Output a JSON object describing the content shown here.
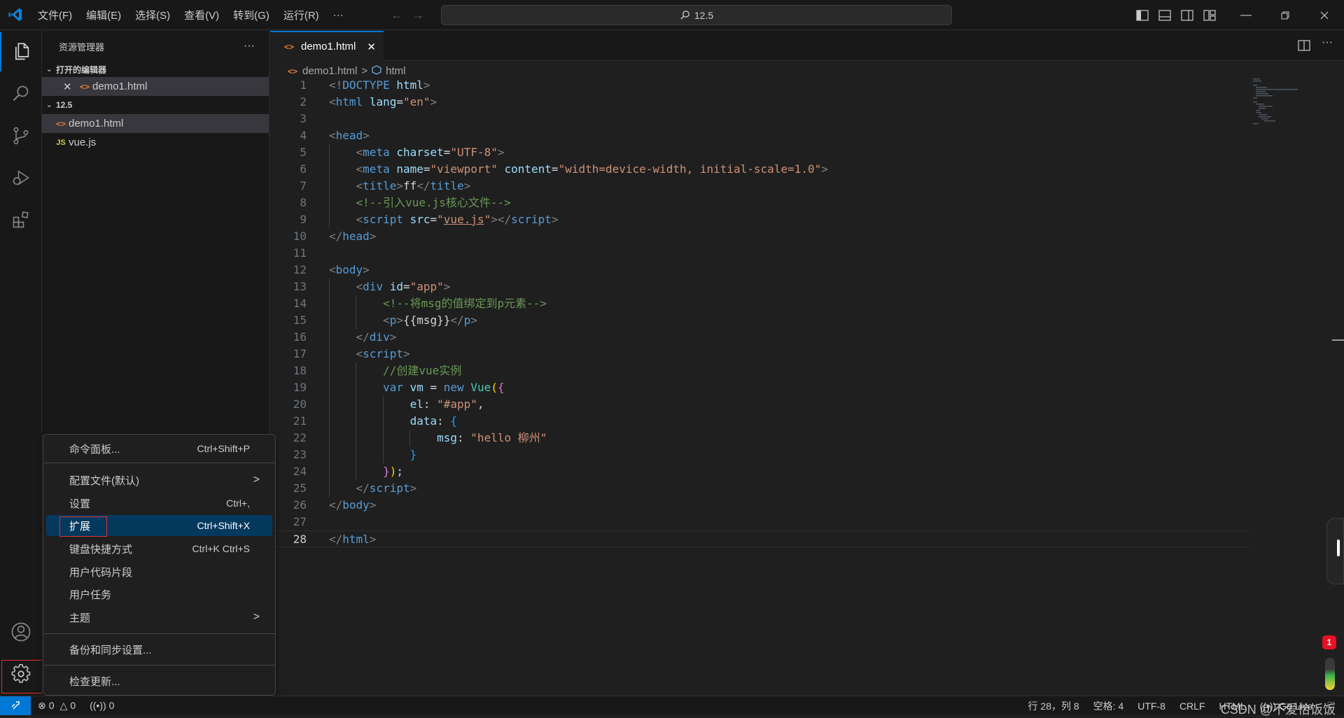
{
  "titlebar": {
    "menus": [
      "文件(F)",
      "编辑(E)",
      "选择(S)",
      "查看(V)",
      "转到(G)",
      "运行(R)",
      "···"
    ],
    "search": "12.5"
  },
  "sidebar": {
    "title": "资源管理器",
    "more": "···",
    "open_editors_title": "打开的编辑器",
    "open_editors": [
      {
        "name": "demo1.html"
      }
    ],
    "folder_title": "12.5",
    "files": [
      {
        "name": "demo1.html",
        "icon": "<>",
        "type": "html"
      },
      {
        "name": "vue.js",
        "icon": "JS",
        "type": "js"
      }
    ]
  },
  "tab": {
    "label": "demo1.html"
  },
  "breadcrumb": {
    "file": "demo1.html",
    "sep": ">",
    "symbol": "html"
  },
  "editor": {
    "lines": [
      [
        [
          "t-tag",
          "<!"
        ],
        [
          "t-name",
          "DOCTYPE"
        ],
        [
          "t-txt",
          " "
        ],
        [
          "t-attr",
          "html"
        ],
        [
          "t-tag",
          ">"
        ]
      ],
      [
        [
          "t-tag",
          "<"
        ],
        [
          "t-name",
          "html"
        ],
        [
          "t-txt",
          " "
        ],
        [
          "t-attr",
          "lang"
        ],
        [
          "t-txt",
          "="
        ],
        [
          "t-str",
          "\"en\""
        ],
        [
          "t-tag",
          ">"
        ]
      ],
      [],
      [
        [
          "t-tag",
          "<"
        ],
        [
          "t-name",
          "head"
        ],
        [
          "t-tag",
          ">"
        ]
      ],
      [
        [
          "t-txt",
          "    "
        ],
        [
          "t-tag",
          "<"
        ],
        [
          "t-name",
          "meta"
        ],
        [
          "t-txt",
          " "
        ],
        [
          "t-attr",
          "charset"
        ],
        [
          "t-txt",
          "="
        ],
        [
          "t-str",
          "\"UTF-8\""
        ],
        [
          "t-tag",
          ">"
        ]
      ],
      [
        [
          "t-txt",
          "    "
        ],
        [
          "t-tag",
          "<"
        ],
        [
          "t-name",
          "meta"
        ],
        [
          "t-txt",
          " "
        ],
        [
          "t-attr",
          "name"
        ],
        [
          "t-txt",
          "="
        ],
        [
          "t-str",
          "\"viewport\""
        ],
        [
          "t-txt",
          " "
        ],
        [
          "t-attr",
          "content"
        ],
        [
          "t-txt",
          "="
        ],
        [
          "t-str",
          "\"width=device-width, initial-scale=1.0\""
        ],
        [
          "t-tag",
          ">"
        ]
      ],
      [
        [
          "t-txt",
          "    "
        ],
        [
          "t-tag",
          "<"
        ],
        [
          "t-name",
          "title"
        ],
        [
          "t-tag",
          ">"
        ],
        [
          "t-txt",
          "ff"
        ],
        [
          "t-tag",
          "</"
        ],
        [
          "t-name",
          "title"
        ],
        [
          "t-tag",
          ">"
        ]
      ],
      [
        [
          "t-txt",
          "    "
        ],
        [
          "t-com",
          "<!--引入vue.js核心文件-->"
        ]
      ],
      [
        [
          "t-txt",
          "    "
        ],
        [
          "t-tag",
          "<"
        ],
        [
          "t-name",
          "script"
        ],
        [
          "t-txt",
          " "
        ],
        [
          "t-attr",
          "src"
        ],
        [
          "t-txt",
          "="
        ],
        [
          "t-str",
          "\""
        ],
        [
          "t-str u",
          "vue.js"
        ],
        [
          "t-str",
          "\""
        ],
        [
          "t-tag",
          "></"
        ],
        [
          "t-name",
          "script"
        ],
        [
          "t-tag",
          ">"
        ]
      ],
      [
        [
          "t-tag",
          "</"
        ],
        [
          "t-name",
          "head"
        ],
        [
          "t-tag",
          ">"
        ]
      ],
      [],
      [
        [
          "t-tag",
          "<"
        ],
        [
          "t-name",
          "body"
        ],
        [
          "t-tag",
          ">"
        ]
      ],
      [
        [
          "t-txt",
          "    "
        ],
        [
          "t-tag",
          "<"
        ],
        [
          "t-name",
          "div"
        ],
        [
          "t-txt",
          " "
        ],
        [
          "t-attr",
          "id"
        ],
        [
          "t-txt",
          "="
        ],
        [
          "t-str",
          "\"app\""
        ],
        [
          "t-tag",
          ">"
        ]
      ],
      [
        [
          "t-txt",
          "        "
        ],
        [
          "t-com",
          "<!--将msg的值绑定到p元素-->"
        ]
      ],
      [
        [
          "t-txt",
          "        "
        ],
        [
          "t-tag",
          "<"
        ],
        [
          "t-name",
          "p"
        ],
        [
          "t-tag",
          ">"
        ],
        [
          "t-txt",
          "{{msg}}"
        ],
        [
          "t-tag",
          "</"
        ],
        [
          "t-name",
          "p"
        ],
        [
          "t-tag",
          ">"
        ]
      ],
      [
        [
          "t-txt",
          "    "
        ],
        [
          "t-tag",
          "</"
        ],
        [
          "t-name",
          "div"
        ],
        [
          "t-tag",
          ">"
        ]
      ],
      [
        [
          "t-txt",
          "    "
        ],
        [
          "t-tag",
          "<"
        ],
        [
          "t-name",
          "script"
        ],
        [
          "t-tag",
          ">"
        ]
      ],
      [
        [
          "t-txt",
          "        "
        ],
        [
          "t-com",
          "//创建vue实例"
        ]
      ],
      [
        [
          "t-txt",
          "        "
        ],
        [
          "t-kw",
          "var"
        ],
        [
          "t-txt",
          " "
        ],
        [
          "t-var",
          "vm"
        ],
        [
          "t-txt",
          " = "
        ],
        [
          "t-kw",
          "new"
        ],
        [
          "t-txt",
          " "
        ],
        [
          "t-fn",
          "Vue"
        ],
        [
          "t-br1",
          "("
        ],
        [
          "t-br2",
          "{"
        ]
      ],
      [
        [
          "t-txt",
          "            "
        ],
        [
          "t-var",
          "el"
        ],
        [
          "t-txt",
          ": "
        ],
        [
          "t-str",
          "\"#app\""
        ],
        [
          "t-txt",
          ","
        ]
      ],
      [
        [
          "t-txt",
          "            "
        ],
        [
          "t-var",
          "data"
        ],
        [
          "t-txt",
          ": "
        ],
        [
          "t-br3",
          "{"
        ]
      ],
      [
        [
          "t-txt",
          "                "
        ],
        [
          "t-var",
          "msg"
        ],
        [
          "t-txt",
          ": "
        ],
        [
          "t-str",
          "\"hello 柳州\""
        ]
      ],
      [
        [
          "t-txt",
          "            "
        ],
        [
          "t-br3",
          "}"
        ]
      ],
      [
        [
          "t-txt",
          "        "
        ],
        [
          "t-br2",
          "}"
        ],
        [
          "t-br1",
          ")"
        ],
        [
          "t-txt",
          ";"
        ]
      ],
      [
        [
          "t-txt",
          "    "
        ],
        [
          "t-tag",
          "</"
        ],
        [
          "t-name",
          "script"
        ],
        [
          "t-tag",
          ">"
        ]
      ],
      [
        [
          "t-tag",
          "</"
        ],
        [
          "t-name",
          "body"
        ],
        [
          "t-tag",
          ">"
        ]
      ],
      [],
      [
        [
          "t-tag",
          "</"
        ],
        [
          "t-name",
          "html"
        ],
        [
          "t-tag",
          ">"
        ]
      ]
    ]
  },
  "context_menu": {
    "items": [
      {
        "label": "命令面板...",
        "shortcut": "Ctrl+Shift+P"
      },
      {
        "label": "配置文件(默认)",
        "submenu": ">"
      },
      {
        "label": "设置",
        "shortcut": "Ctrl+,"
      },
      {
        "label": "扩展",
        "shortcut": "Ctrl+Shift+X",
        "highlighted": true
      },
      {
        "label": "键盘快捷方式",
        "shortcut": "Ctrl+K Ctrl+S"
      },
      {
        "label": "用户代码片段"
      },
      {
        "label": "用户任务"
      },
      {
        "label": "主题",
        "submenu": ">"
      },
      {
        "label": "备份和同步设置..."
      },
      {
        "label": "检查更新..."
      }
    ]
  },
  "statusbar": {
    "errors": "0",
    "warnings": "0",
    "ports": "0",
    "position": "行 28，列 8",
    "spaces": "空格: 4",
    "encoding": "UTF-8",
    "eol": "CRLF",
    "language": "HTML",
    "golive": "Go Live",
    "notification_count": "1"
  },
  "watermark": "CSDN @不爱恰饭饭",
  "colors": {
    "accent": "#0078d4",
    "menu_highlight": "#04395e",
    "annotation_red": "#e03232"
  }
}
